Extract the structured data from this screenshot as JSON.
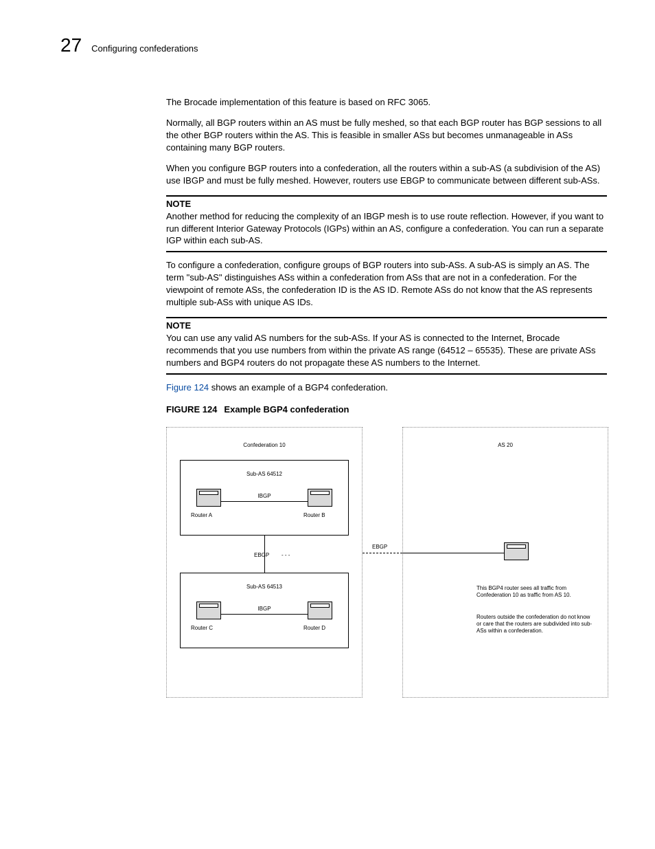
{
  "header": {
    "page_number": "27",
    "section": "Configuring confederations"
  },
  "body": {
    "p1": "The Brocade implementation of this feature is based on RFC 3065.",
    "p2": "Normally, all BGP routers within an AS must be fully meshed, so that each BGP router has BGP sessions to all the other BGP routers within the AS.  This is feasible in smaller ASs but becomes unmanageable in ASs containing many BGP routers.",
    "p3": "When you configure BGP routers into a confederation, all the routers within a sub-AS (a subdivision of the AS) use IBGP and must be fully meshed.  However, routers use EBGP to communicate between different sub-ASs.",
    "note1_label": "NOTE",
    "note1_body": "Another method for reducing the complexity of an IBGP mesh is to use route reflection.  However, if you want to run different Interior Gateway Protocols (IGPs) within an AS, configure a confederation.  You can run a separate IGP within each sub-AS.",
    "p4": "To configure a confederation, configure groups of BGP routers into sub-ASs.  A sub-AS is simply an AS.  The term \"sub-AS\" distinguishes ASs within a confederation from ASs that are not in a confederation.  For the viewpoint of remote ASs, the confederation ID is the AS ID.  Remote ASs do not know that the AS represents multiple sub-ASs with unique AS IDs.",
    "note2_label": "NOTE",
    "note2_body": "You can use any valid AS numbers for the sub-ASs. If your AS is connected to the Internet, Brocade recommends that you use numbers from within the private AS range (64512 – 65535). These are private ASs numbers and BGP4 routers do not propagate these AS numbers to the Internet.",
    "fig_ref_link": "Figure 124",
    "fig_ref_rest": " shows an example of a BGP4 confederation.",
    "fig_caption_num": "FIGURE 124",
    "fig_caption_text": "Example BGP4 confederation"
  },
  "figure": {
    "confed_title": "Confederation 10",
    "as20_title": "AS 20",
    "sub1": "Sub-AS 64512",
    "sub2": "Sub-AS 64513",
    "ibgp": "IBGP",
    "ebgp": "EBGP",
    "routerA": "Router A",
    "routerB": "Router B",
    "routerC": "Router C",
    "routerD": "Router D",
    "note_right_1": "This BGP4 router sees all traffic from Confederation 10 as traffic from AS 10.",
    "note_right_2": "Routers outside the confederation do not know or care that the routers are subdivided into sub-ASs within a confederation."
  }
}
